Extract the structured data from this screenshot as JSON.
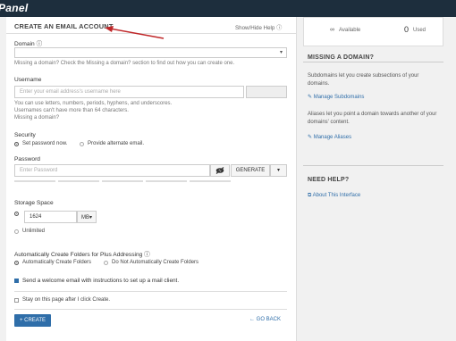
{
  "app": {
    "logo": "Panel"
  },
  "form": {
    "title": "CREATE AN EMAIL ACCOUNT",
    "show_hide_help": "Show/Hide Help",
    "domain": {
      "label": "Domain",
      "hint": "Missing a domain? Check the Missing a domain? section to find out how you can create one."
    },
    "username": {
      "label": "Username",
      "placeholder": "Enter your email address's username here",
      "hint1": "You can use letters, numbers, periods, hyphens, and underscores.",
      "hint2": "Usernames can't have more than 64 characters.",
      "hint3": "Missing a domain?"
    },
    "security": {
      "label": "Security",
      "option1": "Set password now.",
      "option2": "Provide alternate email."
    },
    "password": {
      "label": "Password",
      "placeholder": "Enter Password",
      "generate": "GENERATE"
    },
    "storage": {
      "label": "Storage Space",
      "value": "1624",
      "unit": "MB",
      "unlimited": "Unlimited"
    },
    "folders": {
      "label": "Automatically Create Folders for Plus Addressing",
      "option1": "Automatically Create Folders",
      "option2": "Do Not Automatically Create Folders"
    },
    "welcome_email": "Send a welcome email with instructions to set up a mail client.",
    "stay_on_page": "Stay on this page after I click Create.",
    "create_button": "CREATE",
    "go_back": "GO BACK"
  },
  "sidebar": {
    "stats": {
      "available_label": "Available",
      "used_count": "0",
      "used_label": "Used"
    },
    "missing_domain": {
      "title": "MISSING A DOMAIN?",
      "text1": "Subdomains let you create subsections of your domains.",
      "link1": "Manage Subdomains",
      "text2": "Aliases let you point a domain towards another of your domains' content.",
      "link2": "Manage Aliases"
    },
    "need_help": {
      "title": "NEED HELP?",
      "link": "About This Interface"
    }
  },
  "colors": {
    "topbar": "#1d2e3d",
    "accent": "#2f6ea9",
    "annotation_arrow": "#c0282a"
  },
  "icons": [
    "help-icon",
    "chevron-down-icon",
    "eye-slash-icon",
    "infinity-icon",
    "wrench-icon",
    "external-link-icon",
    "plus-icon",
    "arrow-left-icon"
  ]
}
